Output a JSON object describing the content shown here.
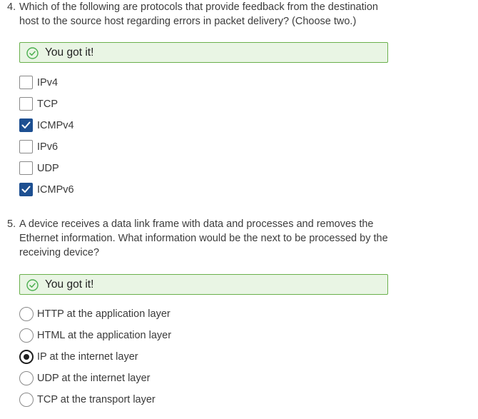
{
  "questions": [
    {
      "number": "4.",
      "text": "Which of the following are protocols that provide feedback from the destination host to the source host regarding errors in packet delivery? (Choose two.)",
      "feedback": "You got it!",
      "feedback_icon": "check-circle-icon",
      "input_type": "checkbox",
      "options": [
        {
          "label": "IPv4",
          "checked": false
        },
        {
          "label": "TCP",
          "checked": false
        },
        {
          "label": "ICMPv4",
          "checked": true
        },
        {
          "label": "IPv6",
          "checked": false
        },
        {
          "label": "UDP",
          "checked": false
        },
        {
          "label": "ICMPv6",
          "checked": true
        }
      ]
    },
    {
      "number": "5.",
      "text": "A device receives a data link frame with data and processes and removes the Ethernet information. What information would be the next to be processed by the receiving device?",
      "feedback": "You got it!",
      "feedback_icon": "check-circle-icon",
      "input_type": "radio",
      "options": [
        {
          "label": "HTTP at the application layer",
          "checked": false
        },
        {
          "label": "HTML at the application layer",
          "checked": false
        },
        {
          "label": "IP at the internet layer",
          "checked": true
        },
        {
          "label": "UDP at the internet layer",
          "checked": false
        },
        {
          "label": "TCP at the transport layer",
          "checked": false
        }
      ]
    }
  ],
  "colors": {
    "feedback_bg": "#e9f5e4",
    "feedback_border": "#6ab04c",
    "checkbox_checked": "#1d4f91",
    "radio_checked": "#1f1f1f"
  }
}
